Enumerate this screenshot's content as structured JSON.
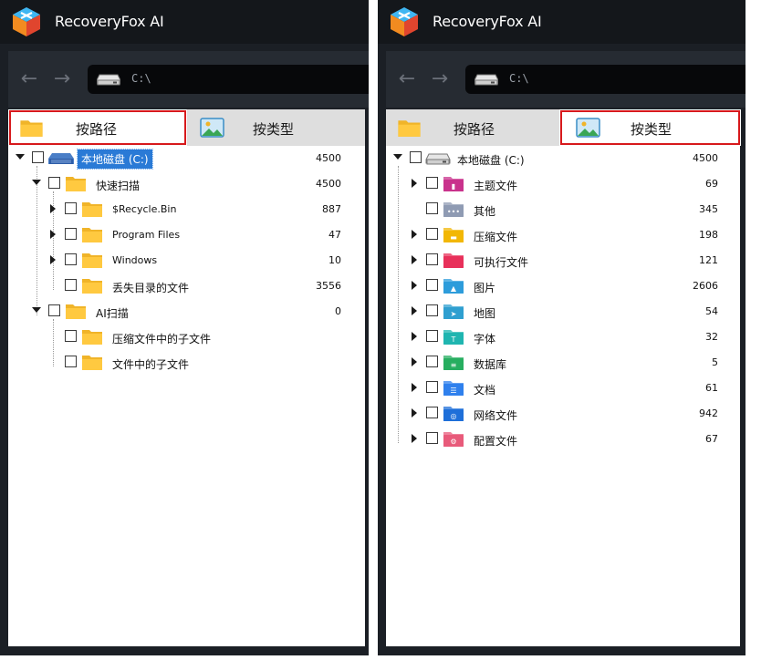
{
  "app": {
    "title": "RecoveryFox AI"
  },
  "nav": {
    "back_icon": "arrow-left-icon",
    "forward_icon": "arrow-right-icon",
    "path": "C:\\"
  },
  "tabs": [
    {
      "label": "按路径",
      "icon": "folder-icon"
    },
    {
      "label": "按类型",
      "icon": "image-icon"
    }
  ],
  "left_tree": {
    "root": {
      "label": "本地磁盘 (C:)",
      "count": "4500"
    },
    "quick": {
      "label": "快速扫描",
      "count": "4500"
    },
    "quick_items": [
      {
        "label": "$Recycle.Bin",
        "count": "887"
      },
      {
        "label": "Program Files",
        "count": "47"
      },
      {
        "label": "Windows",
        "count": "10"
      },
      {
        "label": "丢失目录的文件",
        "count": "3556"
      }
    ],
    "ai": {
      "label": "AI扫描",
      "count": "0"
    },
    "ai_items": [
      {
        "label": "压缩文件中的子文件"
      },
      {
        "label": "文件中的子文件"
      }
    ]
  },
  "right_tree": {
    "root": {
      "label": "本地磁盘 (C:)",
      "count": "4500"
    },
    "types": [
      {
        "label": "主题文件",
        "count": "69",
        "color": "#c9328c"
      },
      {
        "label": "其他",
        "count": "345",
        "color": "#8f9bb3"
      },
      {
        "label": "压缩文件",
        "count": "198",
        "color": "#f2b705"
      },
      {
        "label": "可执行文件",
        "count": "121",
        "color": "#e8305a"
      },
      {
        "label": "图片",
        "count": "2606",
        "color": "#2d9cdb"
      },
      {
        "label": "地图",
        "count": "54",
        "color": "#2f9fd0"
      },
      {
        "label": "字体",
        "count": "32",
        "color": "#1fb5b0"
      },
      {
        "label": "数据库",
        "count": "5",
        "color": "#27ae60"
      },
      {
        "label": "文档",
        "count": "61",
        "color": "#2f80ed"
      },
      {
        "label": "网络文件",
        "count": "942",
        "color": "#1e6fd9"
      },
      {
        "label": "配置文件",
        "count": "67",
        "color": "#e85a7a"
      }
    ]
  }
}
